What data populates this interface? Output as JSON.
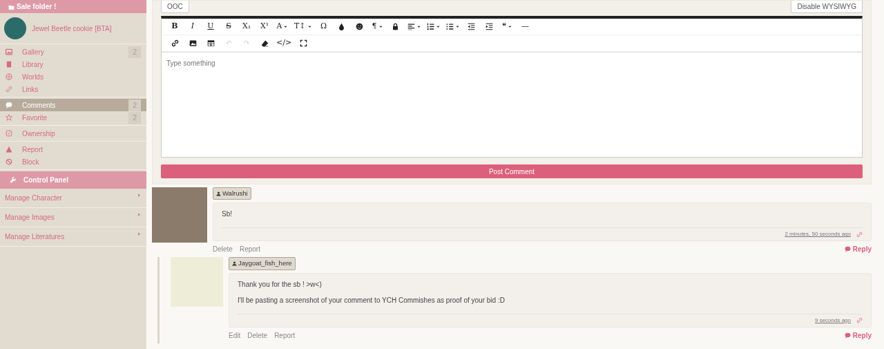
{
  "sidebar": {
    "folder_title": "Sale folder !",
    "character": {
      "name": "Jewel Beetle cookie [BTA]"
    },
    "groups": [
      [
        {
          "label": "Gallery",
          "count": "2",
          "selected": false
        },
        {
          "label": "Library",
          "selected": false
        },
        {
          "label": "Worlds",
          "selected": false
        },
        {
          "label": "Links",
          "selected": false
        }
      ],
      [
        {
          "label": "Comments",
          "count": "2",
          "selected": true
        },
        {
          "label": "Favorite",
          "count": "2",
          "selected": false
        }
      ],
      [
        {
          "label": "Ownership",
          "selected": false
        }
      ],
      [
        {
          "label": "Report",
          "selected": false
        },
        {
          "label": "Block",
          "selected": false
        }
      ]
    ],
    "control_panel": {
      "title": "Control Panel",
      "items": [
        "Manage Character",
        "Manage Images",
        "Manage Literatures"
      ]
    }
  },
  "editor": {
    "ooc_button": "OOC",
    "toggle_button": "Disable WYSIWYG",
    "toolbar_rows": [
      [
        {
          "kind": "text",
          "label": "B"
        },
        {
          "kind": "text",
          "label": "I"
        },
        {
          "kind": "text",
          "label": "U"
        },
        {
          "kind": "text",
          "label": "S"
        },
        {
          "kind": "text",
          "label": "X₁"
        },
        {
          "kind": "text",
          "label": "X¹"
        },
        {
          "kind": "text",
          "label": "A",
          "dropdown": true
        },
        {
          "kind": "text",
          "label": "T↕",
          "dropdown": true
        },
        {
          "kind": "text",
          "label": "Ω"
        },
        {
          "kind": "icon"
        },
        {
          "kind": "icon"
        },
        {
          "kind": "text",
          "label": "¶",
          "dropdown": true
        },
        {
          "kind": "icon"
        },
        {
          "kind": "icon",
          "dropdown": true
        },
        {
          "kind": "icon",
          "dropdown": true
        },
        {
          "kind": "icon",
          "dropdown": true
        },
        {
          "kind": "icon"
        },
        {
          "kind": "icon"
        },
        {
          "kind": "text",
          "label": "❝",
          "dropdown": true
        },
        {
          "kind": "text",
          "label": "—"
        }
      ],
      [
        {
          "kind": "icon"
        },
        {
          "kind": "icon"
        },
        {
          "kind": "icon"
        },
        {
          "kind": "text",
          "label": "↶",
          "disabled": true
        },
        {
          "kind": "text",
          "label": "↷",
          "disabled": true
        },
        {
          "kind": "icon"
        },
        {
          "kind": "text",
          "label": "</>"
        },
        {
          "kind": "icon"
        }
      ]
    ],
    "placeholder": "Type something",
    "submit": "Post Comment"
  },
  "comments": [
    {
      "author": "Walrushi",
      "paragraphs": [
        "Sb!"
      ],
      "time": "2 minutes, 50 seconds ago",
      "actions": [
        "Delete",
        "Report"
      ],
      "reply": "Reply",
      "nested": false
    },
    {
      "author": "Jaygoat_fish_here",
      "paragraphs": [
        "Thank you for the sb ! >w<)",
        "I'll be pasting a screenshot of your comment to YCH Commishes as proof of your bid :D"
      ],
      "time": "9 seconds ago",
      "actions": [
        "Edit",
        "Delete",
        "Report"
      ],
      "reply": "Reply",
      "nested": true
    }
  ]
}
